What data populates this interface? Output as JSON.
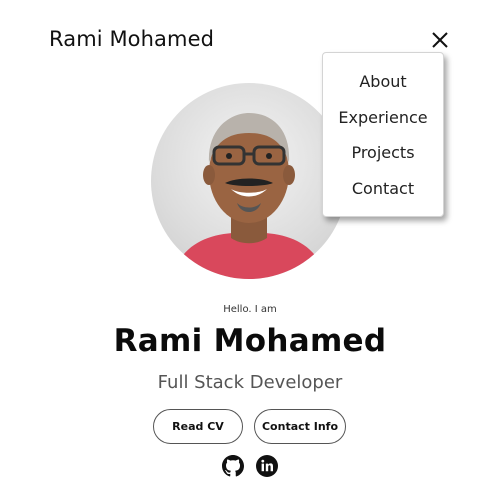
{
  "header": {
    "brand": "Rami Mohamed",
    "close_icon": "close-x-icon"
  },
  "menu": {
    "items": [
      {
        "label": "About"
      },
      {
        "label": "Experience"
      },
      {
        "label": "Projects"
      },
      {
        "label": "Contact"
      }
    ]
  },
  "profile": {
    "greeting": "Hello. I am",
    "name": "Rami Mohamed",
    "role": "Full Stack Developer",
    "photo_icon": "profile-photo"
  },
  "actions": {
    "read_cv": "Read CV",
    "contact_info": "Contact Info"
  },
  "social": {
    "icons": [
      "github-icon",
      "linkedin-icon"
    ]
  },
  "colors": {
    "background": "#ffffff",
    "text": "#111111",
    "muted": "#555555",
    "avatar_shirt": "#d9485c"
  }
}
